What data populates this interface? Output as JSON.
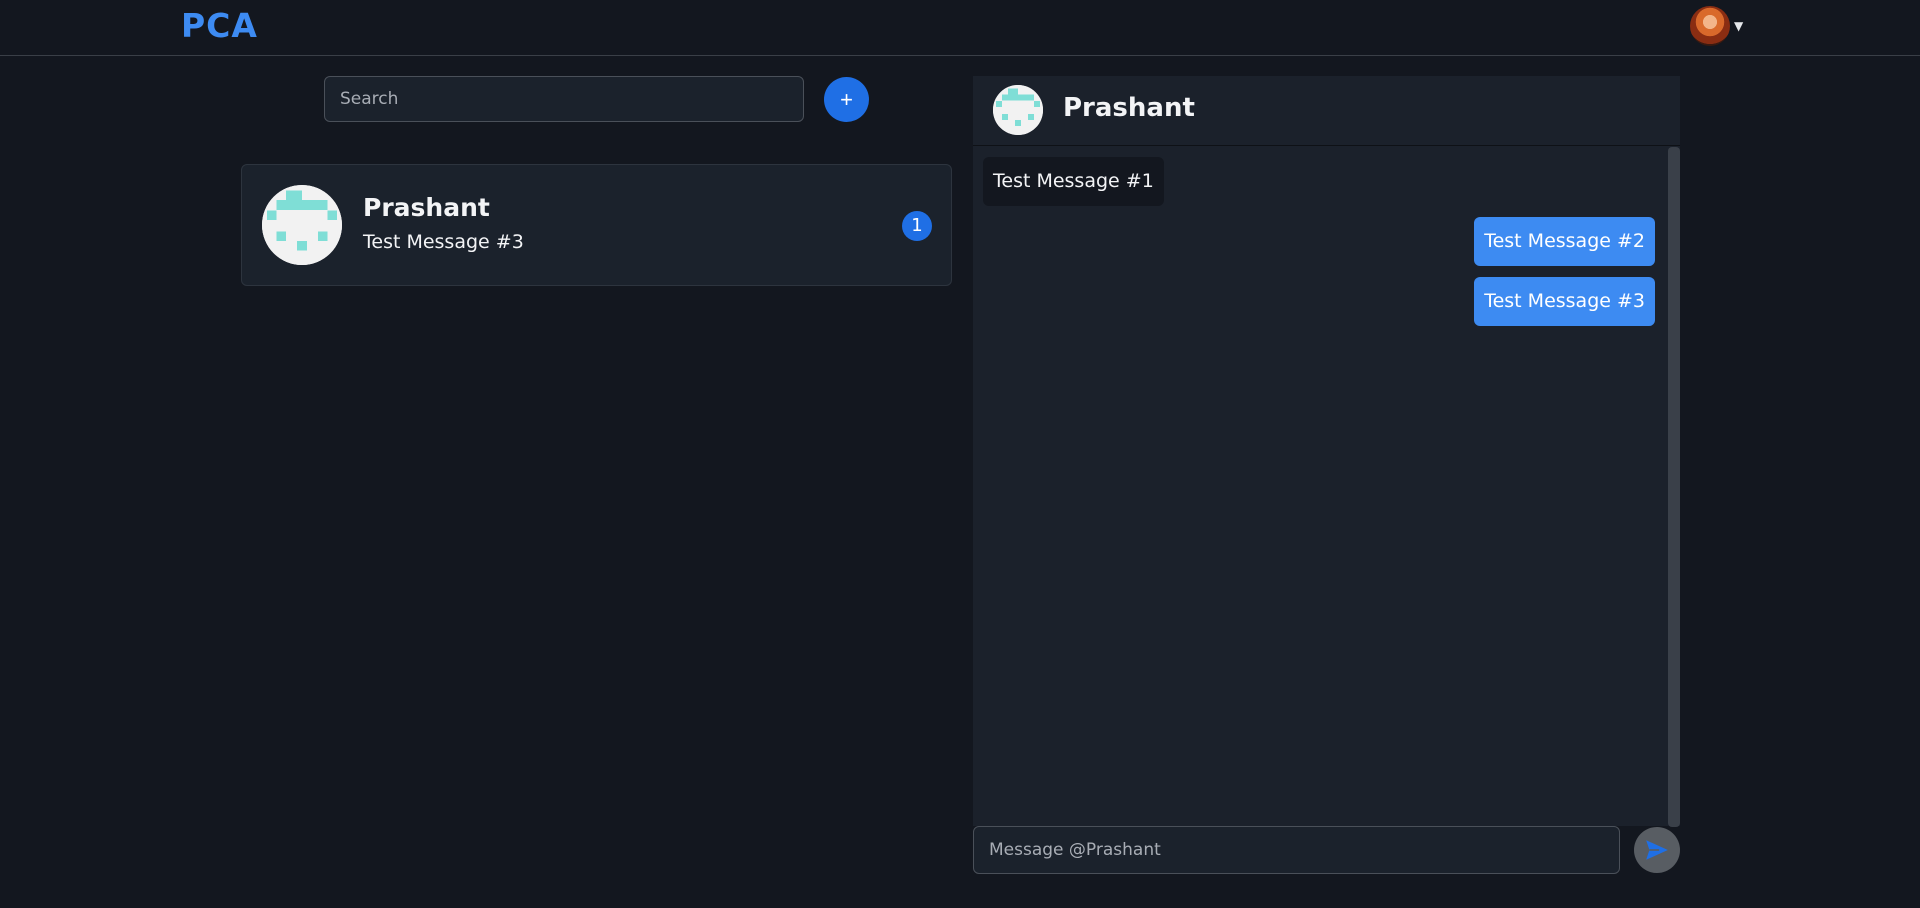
{
  "app": {
    "brand": "PCA"
  },
  "navbar": {
    "profile_avatar_icon": "user-avatar",
    "caret_icon": "caret-down-icon"
  },
  "search": {
    "placeholder": "Search"
  },
  "add_button": {
    "label": "+"
  },
  "conversations": [
    {
      "name": "Prashant",
      "last_message": "Test Message #3",
      "unread": "1"
    }
  ],
  "chat": {
    "title": "Prashant",
    "messages": [
      {
        "text": "Test Message #1",
        "direction": "incoming"
      },
      {
        "text": "Test Message #2",
        "direction": "outgoing"
      },
      {
        "text": "Test Message #3",
        "direction": "outgoing"
      }
    ],
    "input_placeholder": "Message @Prashant",
    "send_icon": "send-icon"
  },
  "colors": {
    "background": "#13171f",
    "panel": "#1b212b",
    "accent": "#1f6fe5",
    "outgoing_bubble": "#3d8bf2",
    "avatar_pattern": "#7fded6"
  }
}
